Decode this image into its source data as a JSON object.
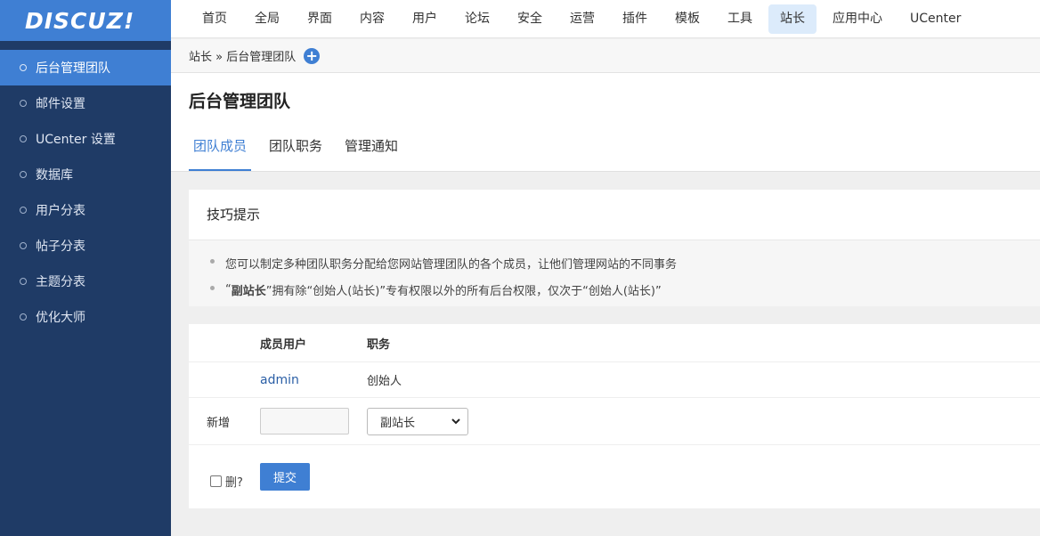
{
  "logo": "DISCUZ!",
  "sidebar": {
    "items": [
      {
        "label": "后台管理团队"
      },
      {
        "label": "邮件设置"
      },
      {
        "label": "UCenter 设置"
      },
      {
        "label": "数据库"
      },
      {
        "label": "用户分表"
      },
      {
        "label": "帖子分表"
      },
      {
        "label": "主题分表"
      },
      {
        "label": "优化大师"
      }
    ]
  },
  "topnav": {
    "items": [
      {
        "label": "首页"
      },
      {
        "label": "全局"
      },
      {
        "label": "界面"
      },
      {
        "label": "内容"
      },
      {
        "label": "用户"
      },
      {
        "label": "论坛"
      },
      {
        "label": "安全"
      },
      {
        "label": "运营"
      },
      {
        "label": "插件"
      },
      {
        "label": "模板"
      },
      {
        "label": "工具"
      },
      {
        "label": "站长"
      },
      {
        "label": "应用中心"
      },
      {
        "label": "UCenter"
      }
    ]
  },
  "breadcrumb": {
    "text": "站长 » 后台管理团队",
    "add_icon": "plus-circle-icon"
  },
  "page": {
    "title": "后台管理团队",
    "tabs": [
      {
        "label": "团队成员"
      },
      {
        "label": "团队职务"
      },
      {
        "label": "管理通知"
      }
    ]
  },
  "tips": {
    "title": "技巧提示",
    "items": [
      {
        "text": "您可以制定多种团队职务分配给您网站管理团队的各个成员，让他们管理网站的不同事务"
      },
      {
        "pre": "“",
        "bold": "副站长",
        "post": "”拥有除“创始人(站长)”专有权限以外的所有后台权限，仅次于“创始人(站长)”"
      }
    ]
  },
  "table": {
    "headers": {
      "member": "成员用户",
      "role": "职务"
    },
    "rows": [
      {
        "member": "admin",
        "role": "创始人"
      }
    ],
    "add_label": "新增",
    "new_member_value": "",
    "role_select_value": "副站长",
    "delete_label": "删?",
    "submit_label": "提交"
  },
  "colors": {
    "accent": "#3f7fd3",
    "sidebar_bg": "#1f3b66",
    "link": "#2b5fa6"
  }
}
